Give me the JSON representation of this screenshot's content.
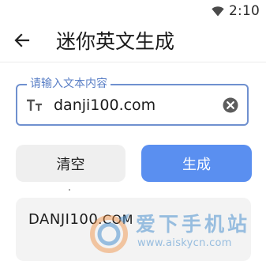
{
  "status_bar": {
    "time": "2:10",
    "wifi_icon": "wifi-icon"
  },
  "app_bar": {
    "back_icon": "arrow-left-icon",
    "title": "迷你英文生成"
  },
  "input": {
    "label": "请输入文本内容",
    "value": "danji100.com",
    "leading_icon": "text-size-icon",
    "trailing_icon": "clear-circle-icon"
  },
  "buttons": {
    "clear_label": "清空",
    "generate_label": "生成"
  },
  "result": {
    "text_large": "DANJI100",
    "text_small": ".COM"
  },
  "watermark": {
    "title": "爱下手机站",
    "url": "www.aiskycn.com"
  },
  "colors": {
    "accent": "#5a8ff0",
    "field_border": "#6f90cf",
    "field_label": "#5a7fc6",
    "button_secondary_bg": "#efefef",
    "card_bg": "#f3f3f3",
    "watermark": "#4a90cd"
  }
}
